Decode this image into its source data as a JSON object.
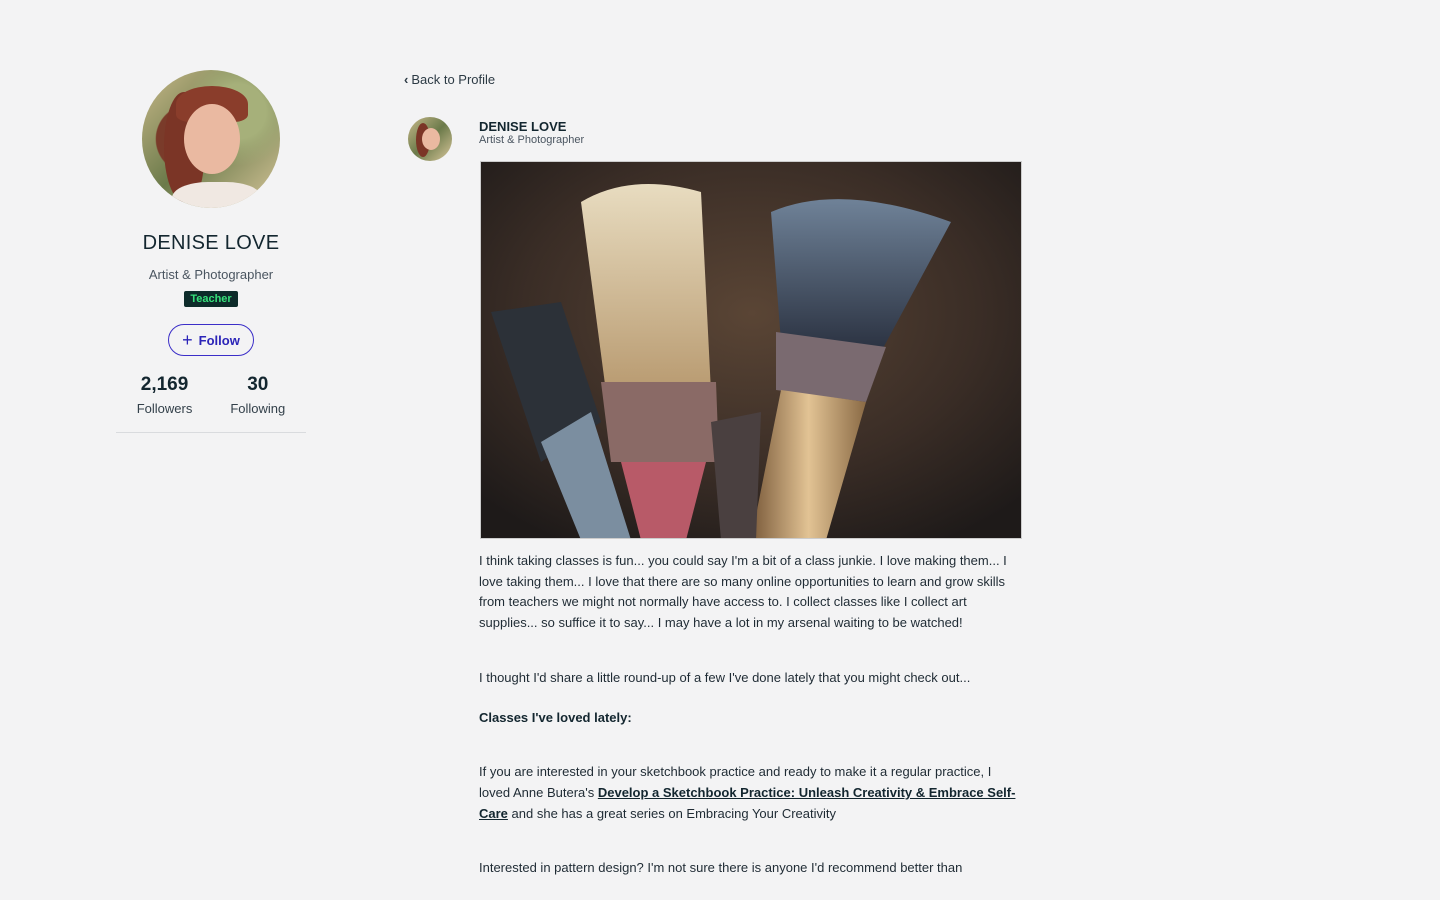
{
  "profile": {
    "name": "DENISE LOVE",
    "title": "Artist & Photographer",
    "badge": "Teacher",
    "follow_label": "Follow",
    "followers_count": "2,169",
    "followers_label": "Followers",
    "following_count": "30",
    "following_label": "Following"
  },
  "nav": {
    "back_label": "Back to Profile"
  },
  "post": {
    "author_name": "DENISE LOVE",
    "author_title": "Artist & Photographer",
    "paragraph1": "I think taking classes is fun...  you could say I'm a bit of a class junkie. I love making them... I love taking them... I love that there are so many online opportunities to learn and grow skills from teachers we might not normally have access to. I collect classes like I collect art supplies... so suffice it to say... I may have a lot in my arsenal waiting to be watched!",
    "paragraph2": "I thought I'd share a little round-up of a few I've done lately that you might check out...",
    "heading": "Classes I've loved lately:",
    "paragraph3_before": "If you are interested in your sketchbook practice and ready to make it a regular practice, I loved Anne Butera's ",
    "paragraph3_link": "Develop a Sketchbook Practice: Unleash Creativity & Embrace Self-Care",
    "paragraph3_after": " and she has a great series on Embracing Your Creativity",
    "paragraph4": "Interested in pattern design? I'm not sure there is anyone I'd recommend better than"
  },
  "colors": {
    "background": "#f3f3f4",
    "accent": "#3b2ec8",
    "badge_bg": "#0d2b2a",
    "badge_text": "#36e07a"
  },
  "icons": {
    "back": "chevron-left-icon",
    "follow": "plus-icon"
  }
}
